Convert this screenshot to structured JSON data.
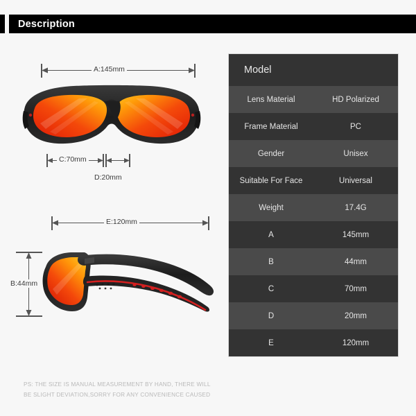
{
  "header": {
    "title": "Description",
    "accent_color": "#000000"
  },
  "diagram": {
    "front_view": {
      "name": "sunglasses-front-view",
      "measurements": [
        {
          "key": "A",
          "label": "A:145mm",
          "orientation": "horizontal"
        },
        {
          "key": "C",
          "label": "C:70mm",
          "orientation": "horizontal"
        },
        {
          "key": "D",
          "label": "D:20mm",
          "orientation": "horizontal"
        }
      ]
    },
    "side_view": {
      "name": "sunglasses-side-view",
      "measurements": [
        {
          "key": "E",
          "label": "E:120mm",
          "orientation": "horizontal"
        },
        {
          "key": "B",
          "label": "B:44mm",
          "orientation": "vertical"
        }
      ]
    },
    "frame_color": "#262626",
    "lens_color_start": "#ffb300",
    "lens_color_end": "#e8260c",
    "accent_stripe_color": "#d42020"
  },
  "disclaimer": {
    "line1": "PS: THE SIZE IS MANUAL MEASUREMENT BY HAND, THERE WILL",
    "line2": "BE SLIGHT DEVIATION,SORRY FOR ANY CONVENIENCE CAUSED"
  },
  "spec_table": {
    "title": "Model",
    "rows": [
      {
        "label": "Lens Material",
        "value": "HD Polarized"
      },
      {
        "label": "Frame Material",
        "value": "PC"
      },
      {
        "label": "Gender",
        "value": "Unisex"
      },
      {
        "label": "Suitable For Face",
        "value": "Universal"
      },
      {
        "label": "Weight",
        "value": "17.4G"
      },
      {
        "label": "A",
        "value": "145mm"
      },
      {
        "label": "B",
        "value": "44mm"
      },
      {
        "label": "C",
        "value": "70mm"
      },
      {
        "label": "D",
        "value": "20mm"
      },
      {
        "label": "E",
        "value": "120mm"
      }
    ]
  }
}
